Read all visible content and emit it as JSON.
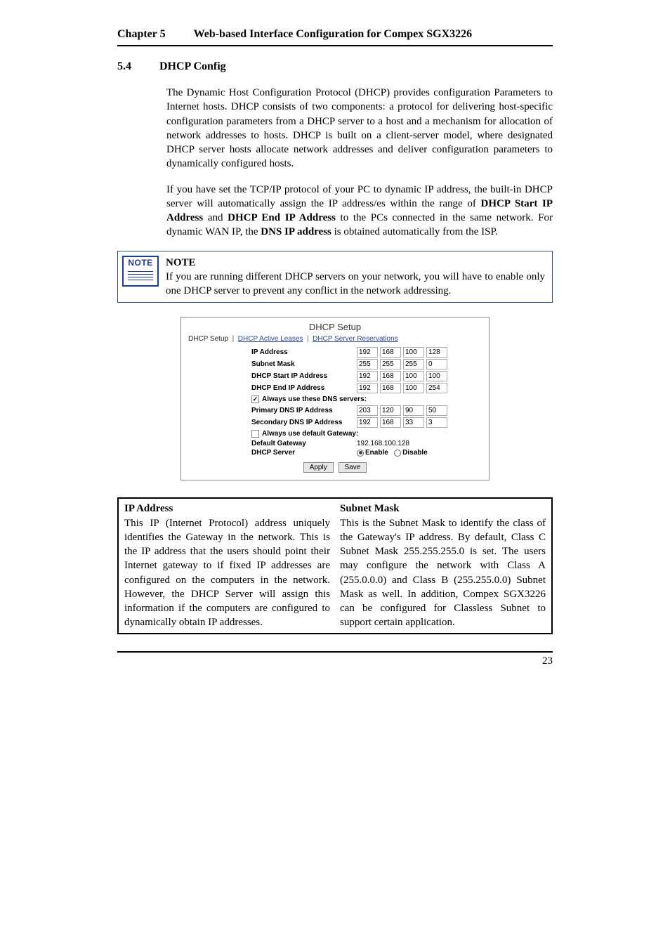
{
  "header": {
    "chapter": "Chapter 5",
    "title": "Web-based Interface Configuration for Compex SGX3226"
  },
  "section": {
    "number": "5.4",
    "title": "DHCP Config"
  },
  "paragraphs": {
    "p1": "The Dynamic Host Configuration Protocol (DHCP) provides configuration Parameters to Internet hosts. DHCP consists of two components: a protocol for delivering host-specific configuration parameters from a DHCP server to a host and a mechanism for allocation of network addresses to hosts. DHCP is built on a client-server model, where designated DHCP server hosts allocate network addresses and deliver configuration parameters to dynamically configured hosts.",
    "p2_a": "If you have set the TCP/IP protocol of your PC to dynamic IP address, the built-in DHCP server will automatically assign the IP address/es within the range of ",
    "p2_b": "DHCP Start IP Address",
    "p2_c": " and ",
    "p2_d": "DHCP End IP Address",
    "p2_e": " to the PCs connected in the same network. For dynamic WAN IP, the ",
    "p2_f": "DNS IP address",
    "p2_g": " is obtained automatically from the ISP."
  },
  "note": {
    "icon_label": "NOTE",
    "title": "NOTE",
    "text": "If you are running different DHCP servers on your network, you will have to enable only one DHCP server to prevent any conflict in the network addressing."
  },
  "dhcp_panel": {
    "title": "DHCP Setup",
    "tabs": {
      "active": "DHCP Setup",
      "link1": "DHCP Active Leases",
      "link2": "DHCP Server Reservations"
    },
    "rows": {
      "ip_address": {
        "label": "IP Address",
        "oct": [
          "192",
          "168",
          "100",
          "128"
        ]
      },
      "subnet_mask": {
        "label": "Subnet Mask",
        "oct": [
          "255",
          "255",
          "255",
          "0"
        ]
      },
      "start_ip": {
        "label": "DHCP Start IP Address",
        "oct": [
          "192",
          "168",
          "100",
          "100"
        ]
      },
      "end_ip": {
        "label": "DHCP End IP Address",
        "oct": [
          "192",
          "168",
          "100",
          "254"
        ]
      },
      "dns_check": "Always use these DNS servers:",
      "primary_dns": {
        "label": "Primary DNS IP Address",
        "oct": [
          "203",
          "120",
          "90",
          "50"
        ]
      },
      "secondary_dns": {
        "label": "Secondary DNS IP Address",
        "oct": [
          "192",
          "168",
          "33",
          "3"
        ]
      },
      "gw_check": "Always use default Gateway:",
      "default_gw": {
        "label": "Default Gateway",
        "value": "192.168.100.128"
      },
      "dhcp_server": {
        "label": "DHCP Server",
        "opt1": "Enable",
        "opt2": "Disable"
      }
    },
    "buttons": {
      "apply": "Apply",
      "save": "Save"
    }
  },
  "definitions": {
    "left": {
      "title": "IP Address",
      "text": "This IP (Internet Protocol) address uniquely identifies the Gateway in the network. This is the IP address that the users should point their Internet gateway to if fixed IP addresses are configured on the computers in the network. However, the DHCP Server will assign this information if the computers are configured to dynamically obtain IP addresses."
    },
    "right": {
      "title": "Subnet Mask",
      "text": "This is the Subnet Mask to identify the class of the Gateway's IP address. By default, Class C Subnet Mask 255.255.255.0 is set. The users may configure the network with Class A (255.0.0.0) and Class B (255.255.0.0) Subnet Mask as well. In addition, Compex SGX3226 can be configured for Classless Subnet to support certain application."
    }
  },
  "footer": {
    "page": "23"
  }
}
